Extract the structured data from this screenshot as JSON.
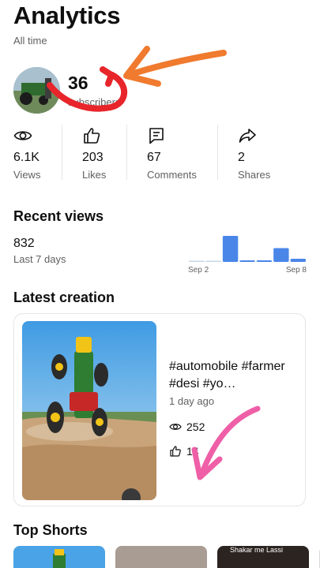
{
  "header": {
    "title": "Analytics",
    "period": "All time"
  },
  "channel": {
    "subscriber_count": "36",
    "subscriber_label": "subscribers"
  },
  "stats": [
    {
      "icon": "eye-icon",
      "value": "6.1K",
      "label": "Views"
    },
    {
      "icon": "thumbs-up-icon",
      "value": "203",
      "label": "Likes"
    },
    {
      "icon": "comment-icon",
      "value": "67",
      "label": "Comments"
    },
    {
      "icon": "share-icon",
      "value": "2",
      "label": "Shares"
    }
  ],
  "recent_views": {
    "title": "Recent views",
    "value": "832",
    "period": "Last 7 days",
    "start_label": "Sep 2",
    "end_label": "Sep 8",
    "daily_fraction": [
      0,
      0,
      1.0,
      0.06,
      0.06,
      0.53,
      0.12
    ],
    "bar_color": "#4a86e8",
    "baseline_color": "#c8d4e6"
  },
  "latest_creation": {
    "section_title": "Latest creation",
    "title": "#automobile #farmer #desi #yo…",
    "time": "1 day ago",
    "views": "252",
    "likes": "14"
  },
  "top_shorts": {
    "section_title": "Top Shorts",
    "overlay_text": "Shakar me Lassi"
  },
  "annotation_colors": {
    "orange_arrow": "#f07a2e",
    "red_arrow": "#e8252b",
    "pink_arrow": "#ef5fa7"
  }
}
